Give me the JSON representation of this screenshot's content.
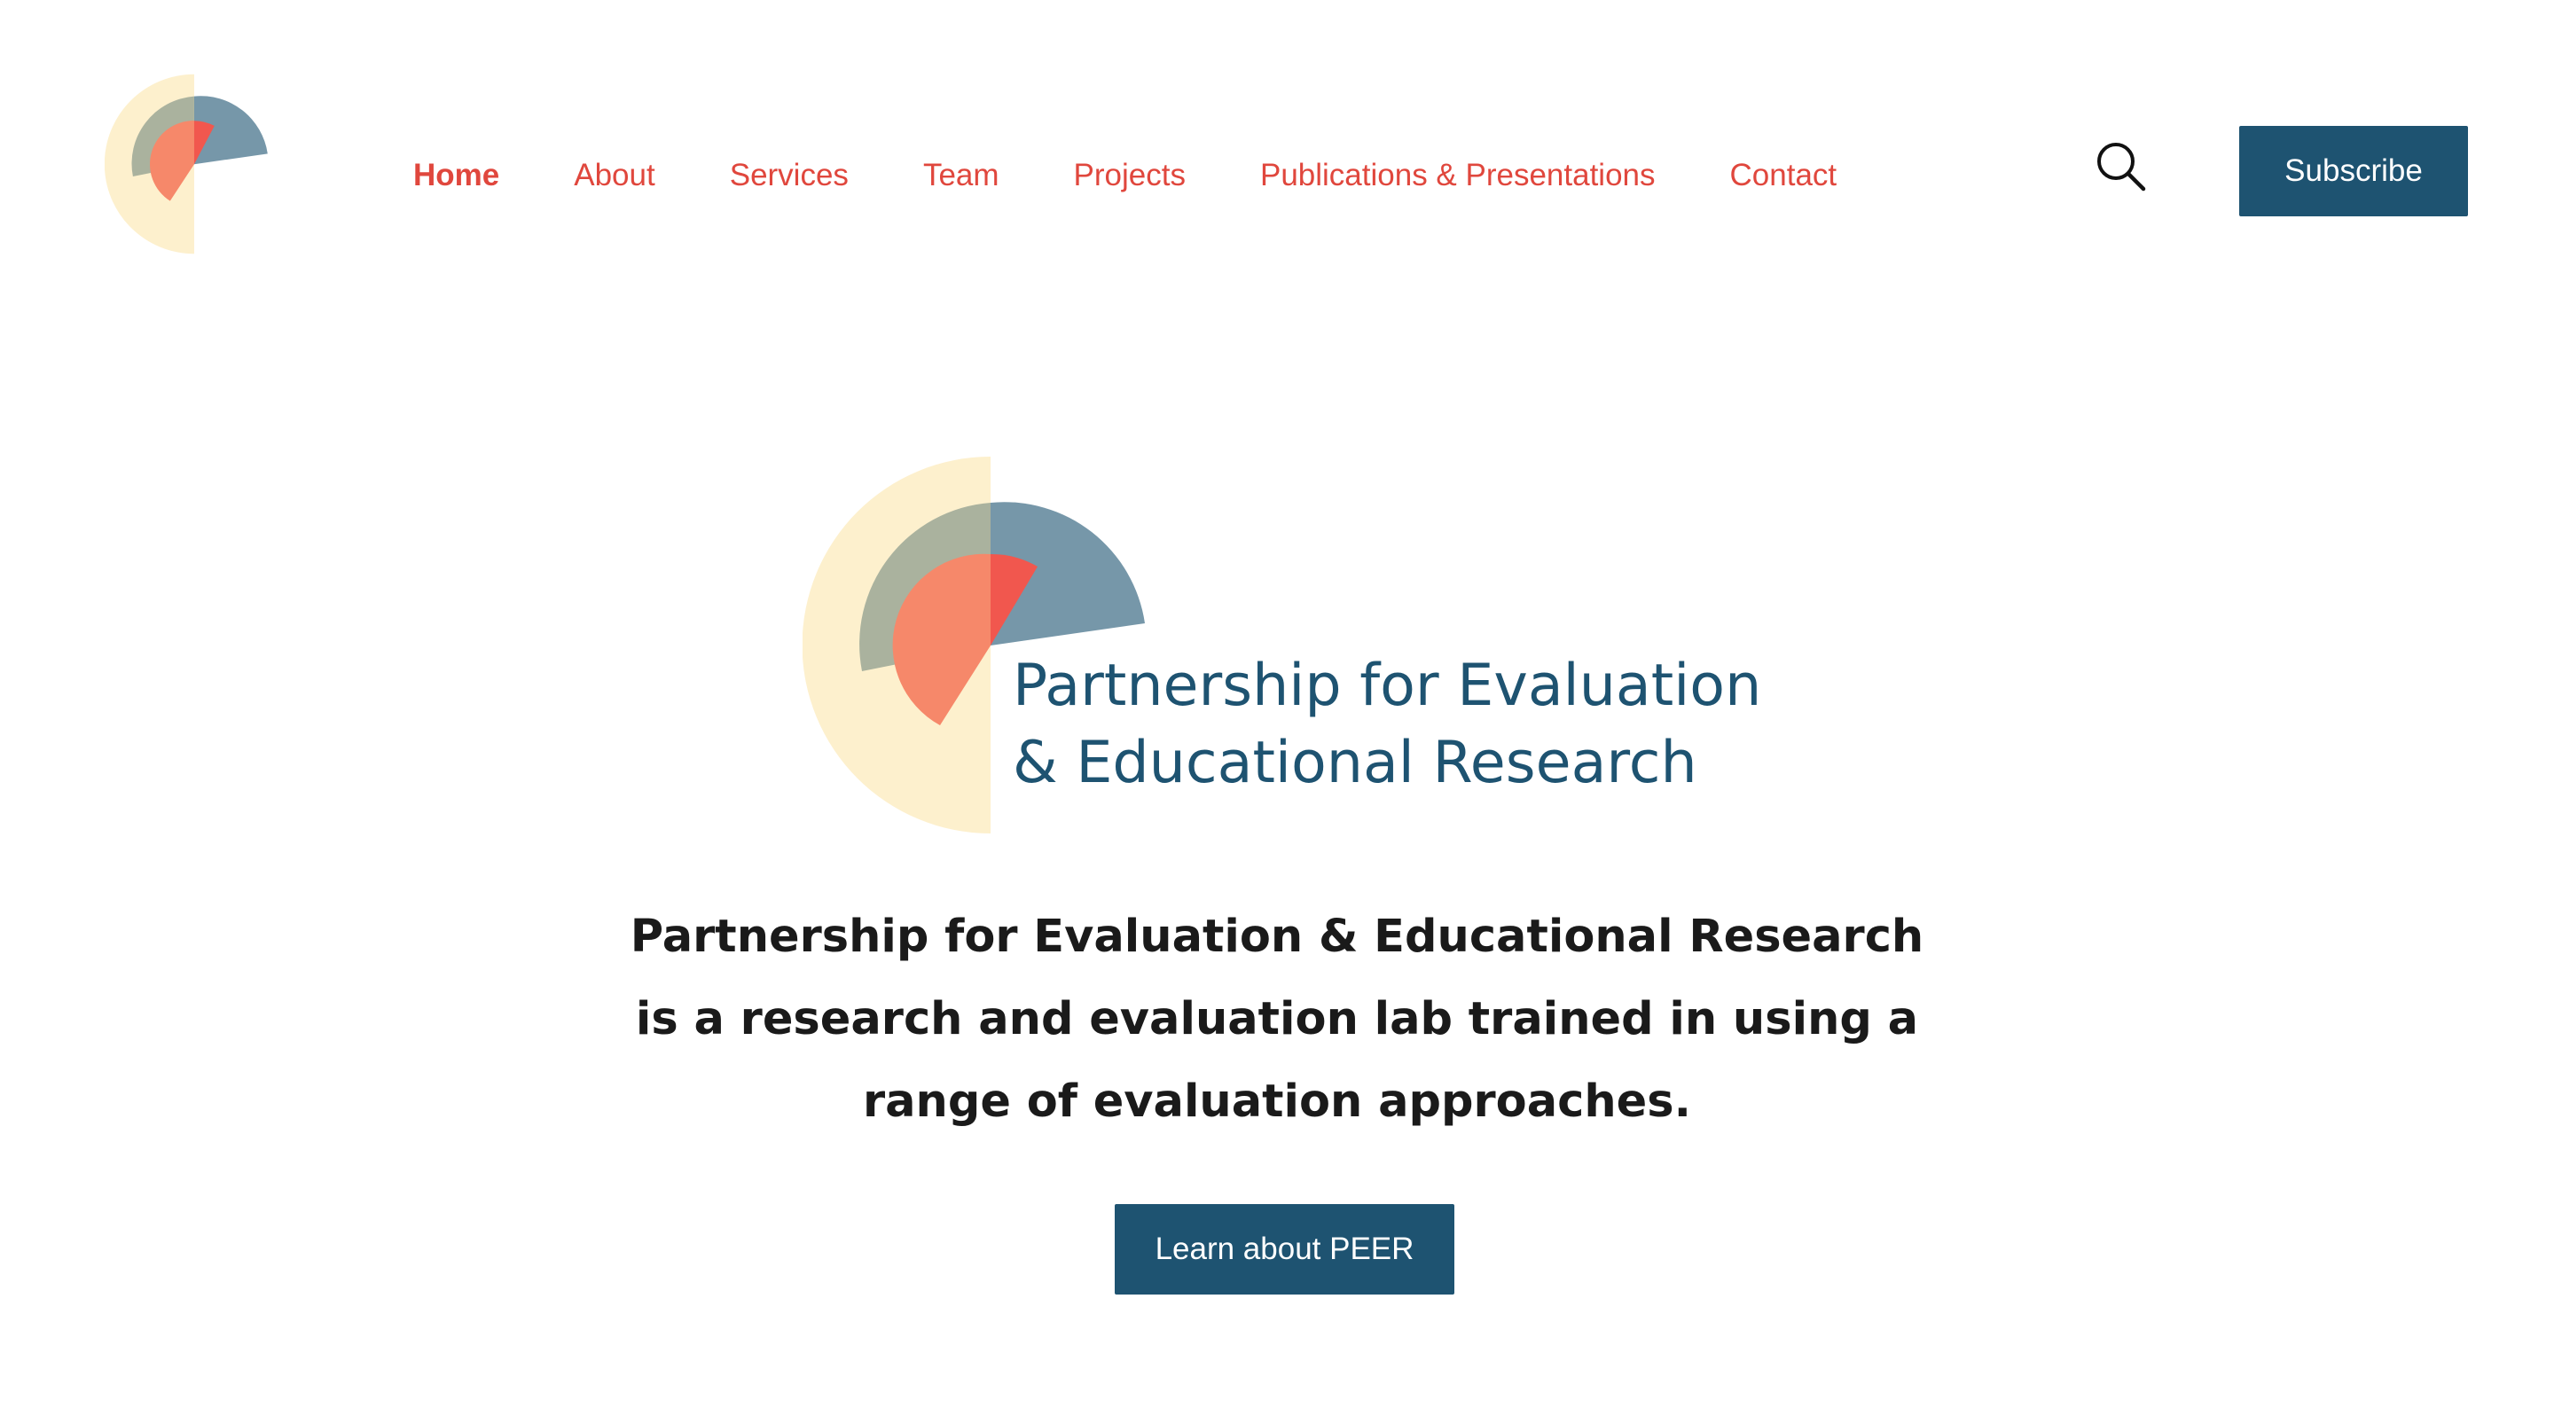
{
  "header": {
    "logo_icon": "peer-logo-mark",
    "nav": [
      {
        "label": "Home",
        "active": true
      },
      {
        "label": "About",
        "active": false
      },
      {
        "label": "Services",
        "active": false
      },
      {
        "label": "Team",
        "active": false
      },
      {
        "label": "Projects",
        "active": false
      },
      {
        "label": "Publications & Presentations",
        "active": false
      },
      {
        "label": "Contact",
        "active": false
      }
    ],
    "search_icon": "search-icon",
    "subscribe_label": "Subscribe"
  },
  "hero": {
    "wordmark_line1": "Partnership for Evaluation",
    "wordmark_line2": "& Educational Research",
    "description": "Partnership for Evaluation & Educational Research is a research and evaluation lab trained in using a range of evaluation approaches.",
    "cta_label": "Learn about PEER"
  },
  "colors": {
    "nav_text": "#e0473d",
    "primary": "#1e5371",
    "body_text": "#1a1a1a",
    "logo_cream": "#fdf0cd",
    "logo_sage": "#aab29e",
    "logo_slate": "#7697a9",
    "logo_salmon": "#f6886a",
    "logo_red": "#f1574e"
  }
}
